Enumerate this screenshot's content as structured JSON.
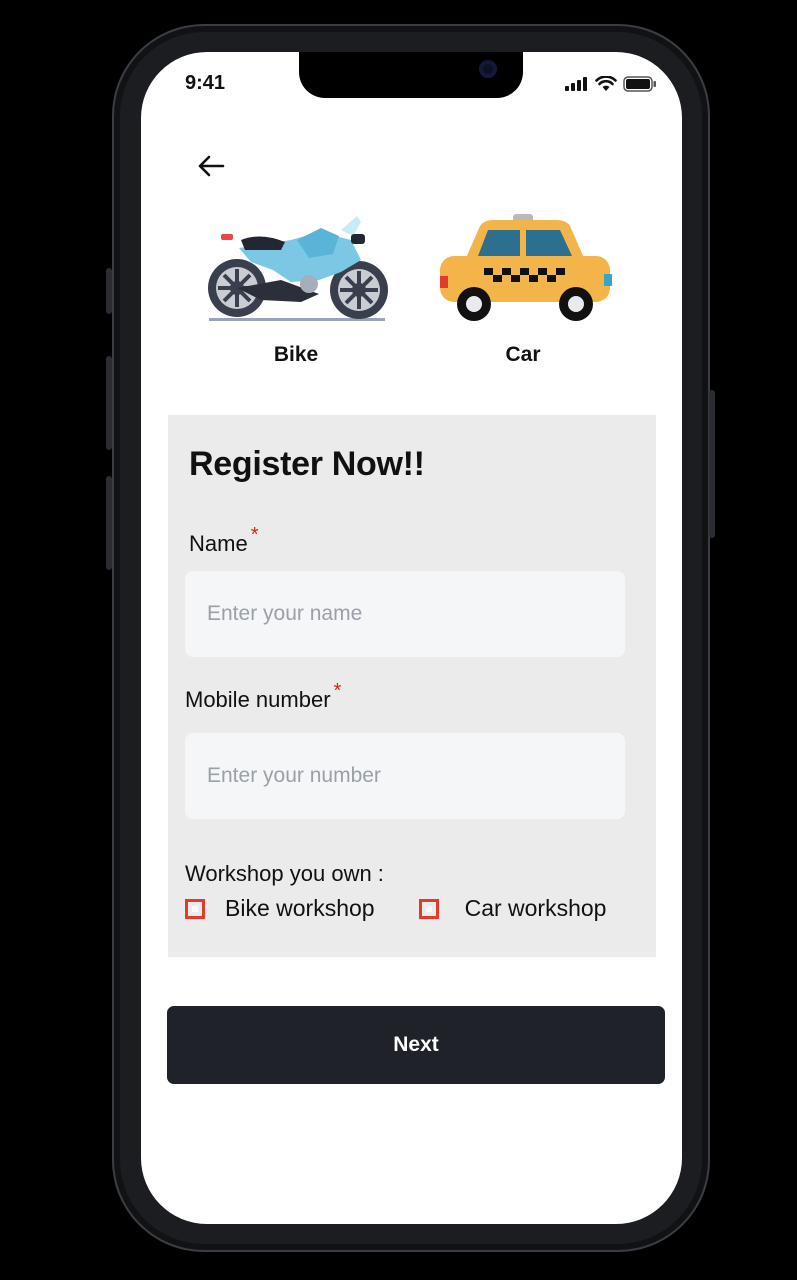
{
  "status_bar": {
    "time": "9:41"
  },
  "vehicles": [
    {
      "label": "Bike",
      "icon": "motorcycle-icon"
    },
    {
      "label": "Car",
      "icon": "taxi-car-icon"
    }
  ],
  "form": {
    "title": "Register Now!!",
    "name_label": "Name",
    "name_placeholder": "Enter your name",
    "mobile_label": "Mobile number",
    "mobile_placeholder": "Enter your number",
    "required_marker": "*",
    "workshop_label": "Workshop you own :",
    "options": [
      {
        "label": "Bike workshop"
      },
      {
        "label": "Car workshop"
      }
    ]
  },
  "next_label": "Next",
  "colors": {
    "accent_red": "#e23b2e",
    "button_dark": "#1f2229",
    "card_bg": "#ebebeb"
  }
}
